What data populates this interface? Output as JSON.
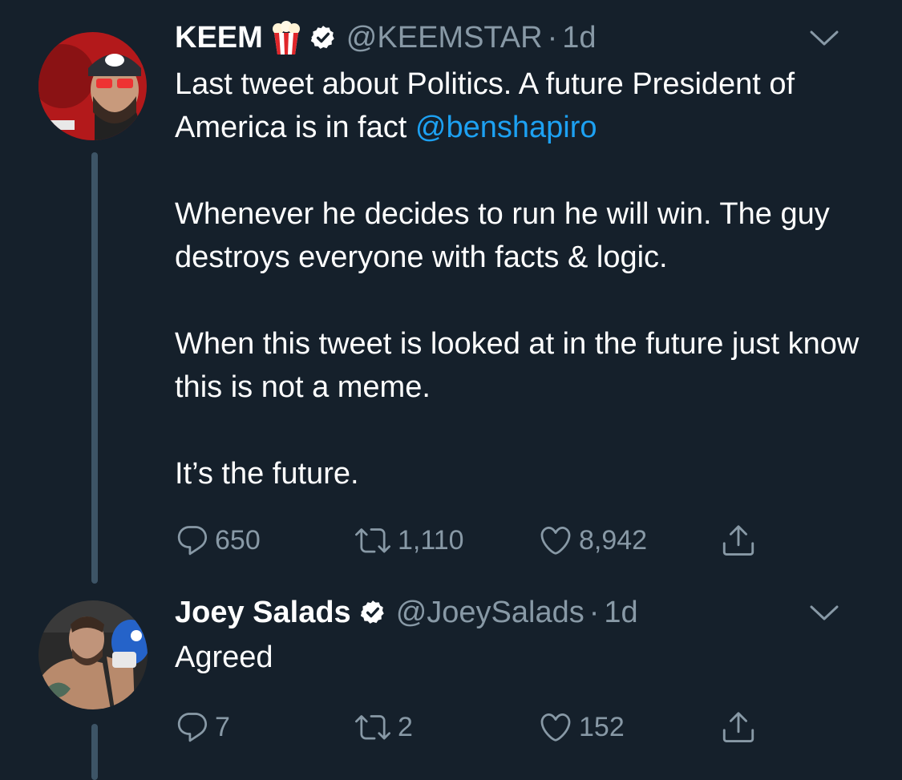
{
  "tweets": [
    {
      "name": "KEEM",
      "handle": "@KEEMSTAR",
      "separator": "·",
      "time": "1d",
      "body": [
        {
          "pre": "Last tweet about Politics. A future President of America is in fact ",
          "mention": "@benshapiro"
        },
        {
          "text": "Whenever he decides to run he will win. The guy destroys everyone with facts & logic."
        },
        {
          "text": "When this tweet is looked at in the future just know this is not a meme."
        },
        {
          "text": "It’s the future."
        }
      ],
      "stats": {
        "replies": "650",
        "retweets": "1,110",
        "likes": "8,942"
      }
    },
    {
      "name": "Joey Salads",
      "handle": "@JoeySalads",
      "separator": "·",
      "time": "1d",
      "body": [
        {
          "text": "Agreed"
        }
      ],
      "stats": {
        "replies": "7",
        "retweets": "2",
        "likes": "152"
      }
    }
  ],
  "icons": {
    "emoji": "popcorn-icon",
    "verified": "verified-badge-icon",
    "menu": "chevron-down-icon",
    "reply": "reply-icon",
    "retweet": "retweet-icon",
    "like": "heart-icon",
    "share": "share-icon"
  },
  "colors": {
    "background": "#15202b",
    "text": "#ffffff",
    "secondary": "#8899a6",
    "link": "#1da1f2",
    "thread_line": "#3d5466"
  }
}
